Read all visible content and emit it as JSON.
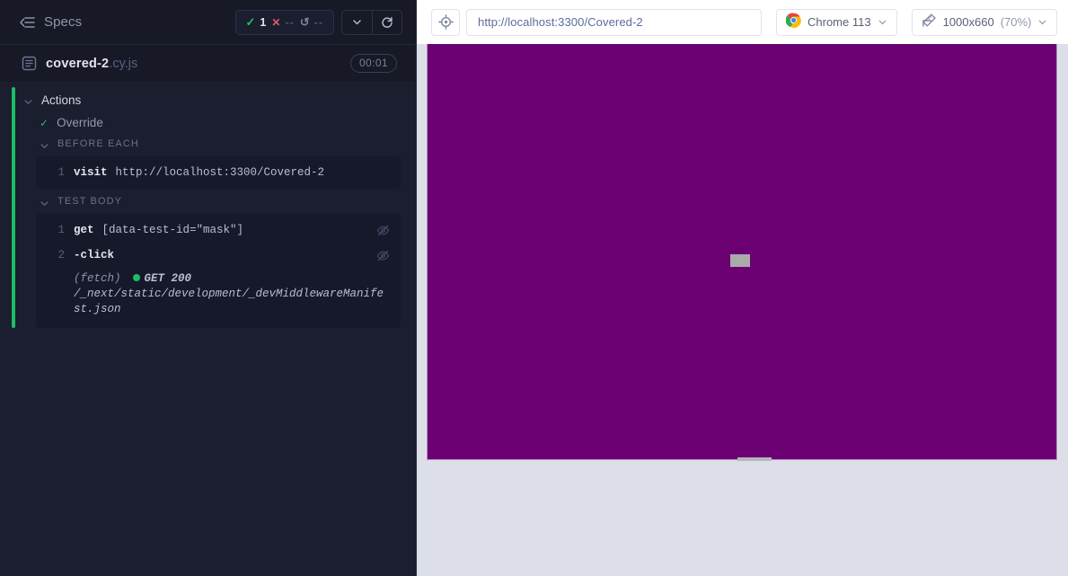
{
  "reporter": {
    "header": {
      "specs_label": "Specs",
      "collapse_icon": "collapse-left-icon",
      "stats": {
        "passed_glyph": "✓",
        "passed_count": "1",
        "failed_glyph": "✕",
        "failed_count": "--",
        "pending_glyph": "↺",
        "pending_count": "--"
      },
      "controls": {
        "chevron_down_icon": "chevron-down-icon",
        "restart_icon": "restart-icon"
      }
    },
    "spec": {
      "file_icon": "spec-file-icon",
      "name": "covered-2",
      "extension": ".cy.js",
      "duration": "00:01"
    },
    "tree": {
      "suite": {
        "title": "Actions",
        "chevron": "ˇ"
      },
      "test": {
        "check": "✓",
        "title": "Override"
      },
      "hooks": [
        {
          "label": "BEFORE EACH",
          "chevron": "ˇ",
          "commands": [
            {
              "num": "1",
              "method": "visit",
              "arg": "http://localhost:3300/Covered-2",
              "has_eye": false
            }
          ]
        },
        {
          "label": "TEST BODY",
          "chevron": "ˇ",
          "commands": [
            {
              "num": "1",
              "method": "get",
              "arg": "[data-test-id=\"mask\"]",
              "has_eye": true
            },
            {
              "num": "2",
              "method": "-click",
              "arg": "",
              "has_eye": true
            }
          ],
          "route": {
            "kind": "(fetch)",
            "status": "GET 200",
            "url": "/_next/static/development/_devMiddlewareManifest.json"
          }
        }
      ]
    }
  },
  "aut": {
    "toolbar": {
      "selector_icon": "selector-playground-icon",
      "url": "http://localhost:3300/Covered-2",
      "browser": {
        "icon": "chrome-icon",
        "label": "Chrome 113",
        "chevron": "ˇ"
      },
      "viewport": {
        "icon": "ruler-icon",
        "label": "1000x660",
        "scale": "(70%)",
        "chevron": "ˇ"
      }
    },
    "app": {
      "background_color": "#6b0072",
      "stage_color": "#dcdee8",
      "elements": [
        {
          "name": "mask-element",
          "color": "#aaaaaa"
        },
        {
          "name": "bottom-edge-element",
          "color": "#b8b4bb"
        }
      ]
    }
  },
  "colors": {
    "reporter_bg": "#1b1e2e",
    "reporter_header_bg": "#171926",
    "pass_green": "#1cbd67",
    "fail_red": "#e45770",
    "command_bg": "#16192a",
    "app_purple": "#6b0072"
  }
}
